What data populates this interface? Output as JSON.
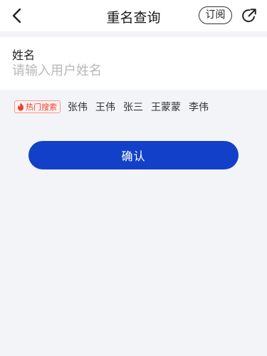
{
  "header": {
    "title": "重名查询",
    "subscribe_label": "订阅"
  },
  "form": {
    "name_label": "姓名",
    "name_placeholder": "请输入用户姓名",
    "name_value": ""
  },
  "hot_search": {
    "badge_label": "热门搜索",
    "items": [
      "张伟",
      "王伟",
      "张三",
      "王蒙蒙",
      "李伟"
    ]
  },
  "actions": {
    "confirm_label": "确认"
  },
  "colors": {
    "primary": "#1240c8",
    "hot": "#e84233",
    "background": "#f3f4f8"
  },
  "icons": {
    "back": "chevron-left-icon",
    "share": "share-arrow-icon",
    "hot": "flame-icon"
  }
}
